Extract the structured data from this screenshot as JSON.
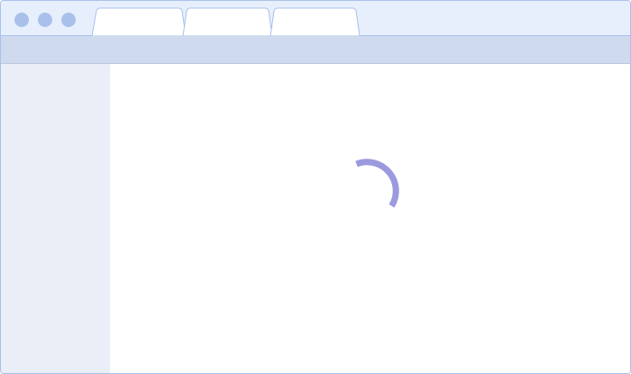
{
  "window": {
    "controls": [
      "close",
      "minimize",
      "maximize"
    ]
  },
  "tabs": [
    {
      "label": ""
    },
    {
      "label": ""
    },
    {
      "label": ""
    }
  ],
  "main": {
    "loading": true,
    "spinner_icon": "loading-spinner-icon"
  },
  "colors": {
    "titlebar": "#e7effd",
    "border": "#a9c1ea",
    "toolbar": "#cfdaee",
    "sidebar": "#e9eef7",
    "spinner": "#9b9ade"
  }
}
